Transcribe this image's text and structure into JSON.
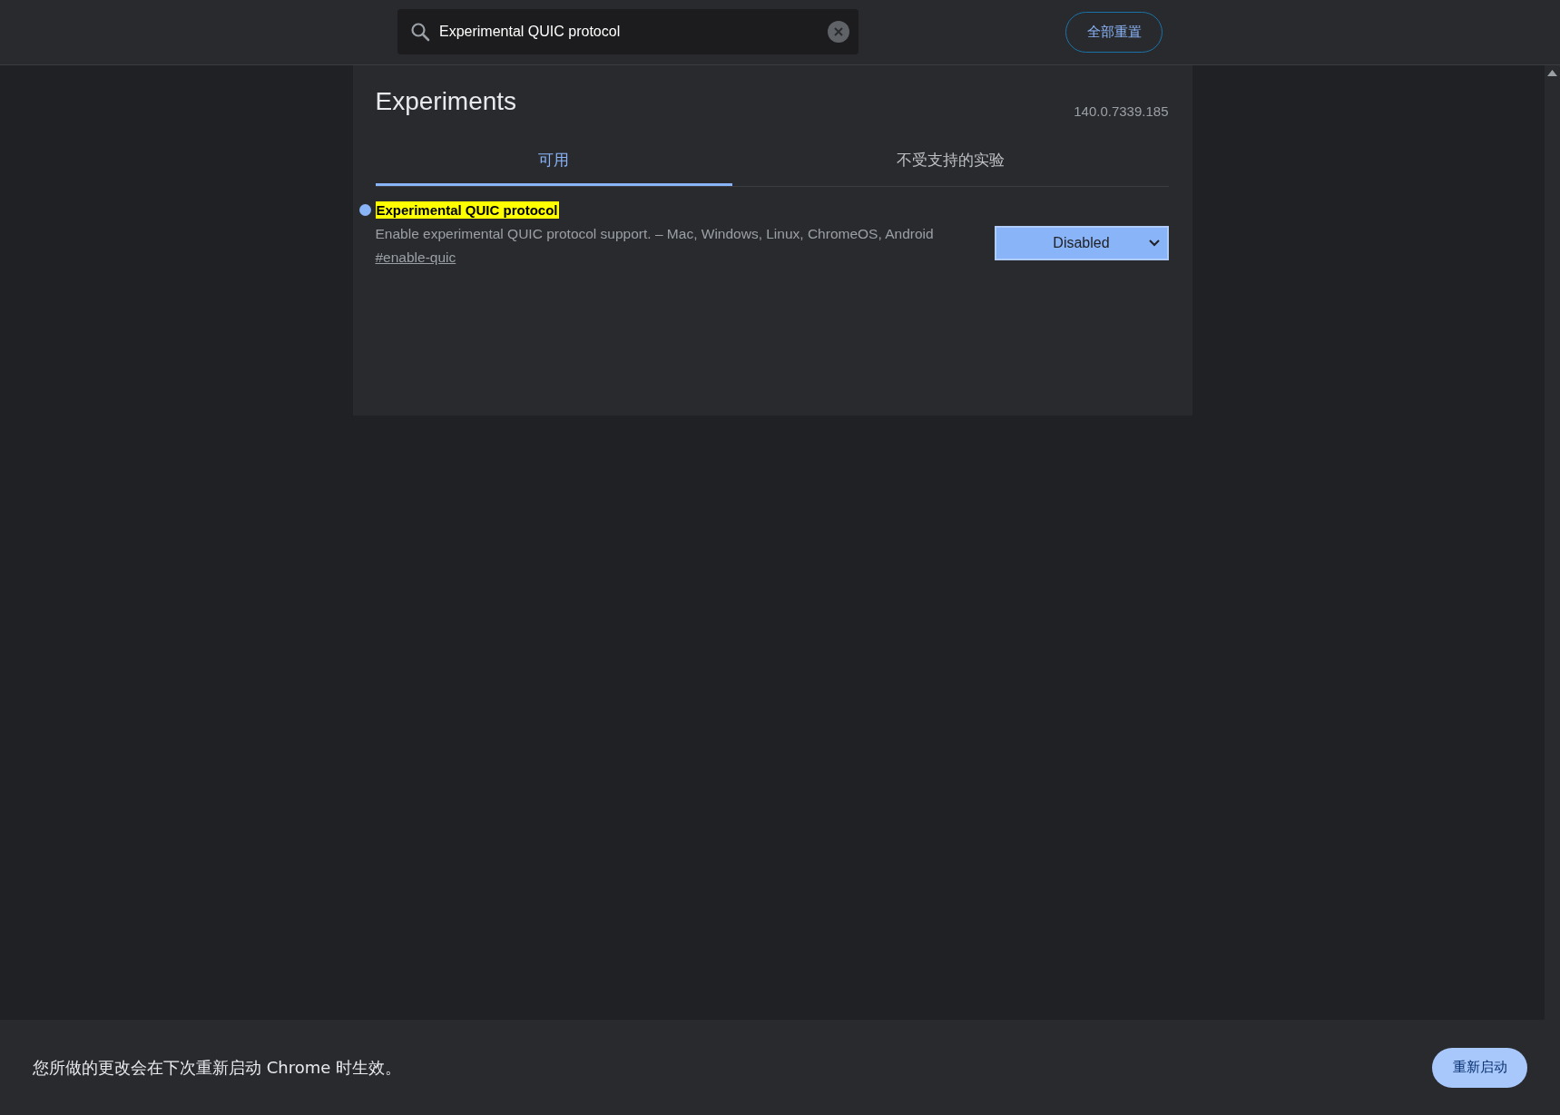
{
  "search": {
    "value": "Experimental QUIC protocol"
  },
  "reset_button": "全部重置",
  "title": "Experiments",
  "version": "140.0.7339.185",
  "tabs": [
    {
      "label": "可用",
      "selected": true
    },
    {
      "label": "不受支持的实验",
      "selected": false
    }
  ],
  "experiments": [
    {
      "name": "Experimental QUIC protocol",
      "highlighted": true,
      "modified": true,
      "description": "Enable experimental QUIC protocol support. – Mac, Windows, Linux, ChromeOS, Android",
      "link": "#enable-quic",
      "value": "Disabled"
    }
  ],
  "notice": "您所做的更改会在下次重新启动 Chrome 时生效。",
  "restart_button": "重新启动"
}
